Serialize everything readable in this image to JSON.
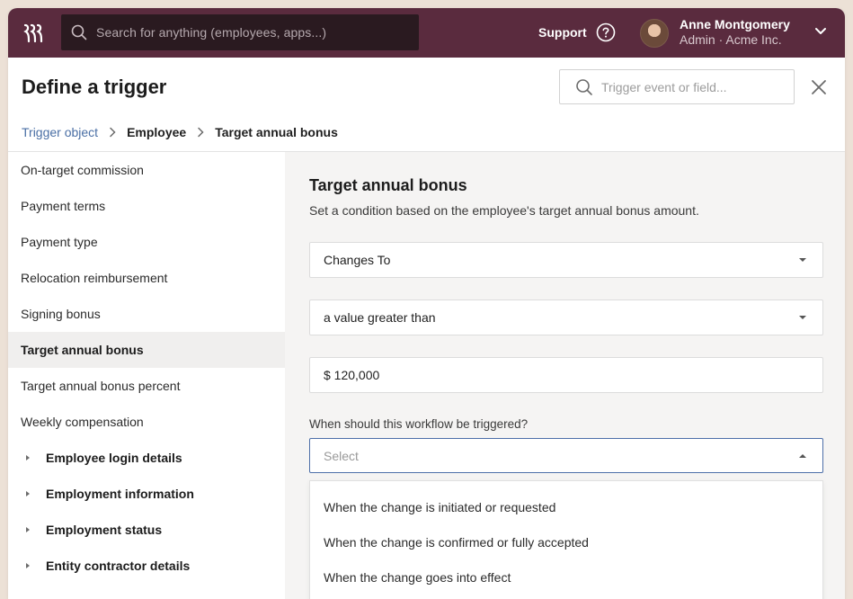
{
  "topbar": {
    "search_placeholder": "Search for anything (employees, apps...)",
    "support_label": "Support",
    "user_name": "Anne Montgomery",
    "user_role": "Admin · Acme Inc.",
    "bar_color": "#5a2b3e"
  },
  "header": {
    "title": "Define a trigger",
    "search_placeholder": "Trigger event or field...",
    "breadcrumb": [
      "Trigger object",
      "Employee",
      "Target annual bonus"
    ]
  },
  "sidebar": {
    "items": [
      "On-target commission",
      "Payment terms",
      "Payment type",
      "Relocation reimbursement",
      "Signing bonus",
      "Target annual bonus",
      "Target annual bonus percent",
      "Weekly compensation"
    ],
    "active_item": "Target annual bonus",
    "groups": [
      "Employee login details",
      "Employment information",
      "Employment status",
      "Entity contractor details"
    ]
  },
  "main": {
    "title": "Target annual bonus",
    "description": "Set a condition based on the employee's target annual bonus amount.",
    "condition_value": "Changes To",
    "comparison_value": "a value greater than",
    "amount_value": "$ 120,000",
    "when_label": "When should this workflow be triggered?",
    "when_placeholder": "Select",
    "options": [
      "When the change is initiated or requested",
      "When the change is confirmed or fully accepted",
      "When the change goes into effect"
    ],
    "focus_color": "#4d6fa8"
  },
  "icons": {
    "logo": "rippling-logo-icon",
    "search": "search-icon",
    "help": "help-circle-icon",
    "chevron": "chevron-down-icon",
    "close": "close-icon",
    "breadcrumb_sep": "chevron-right-icon",
    "caret_down": "caret-down-icon",
    "caret_up": "caret-up-icon",
    "caret_right": "caret-right-icon"
  }
}
